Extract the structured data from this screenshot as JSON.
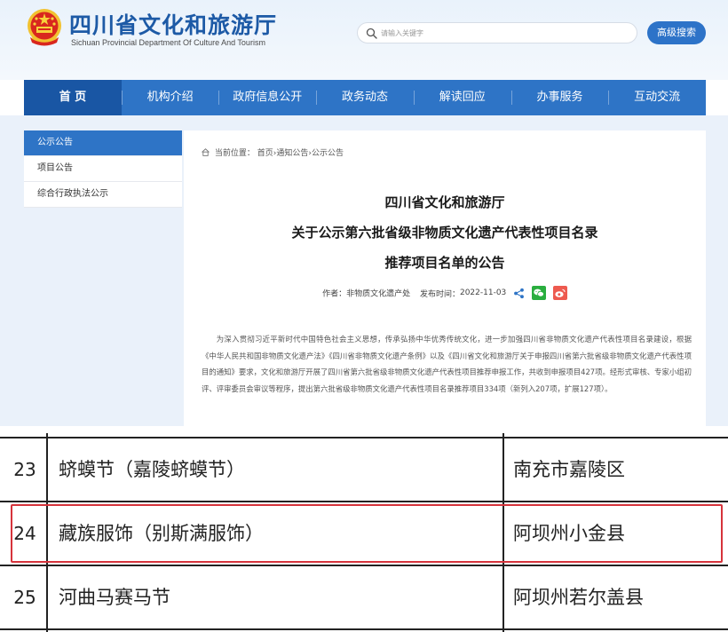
{
  "header": {
    "title": "四川省文化和旅游厅",
    "subtitle": "Sichuan Provincial Department Of Culture And Tourism",
    "search": {
      "placeholder": "请输入关键字",
      "value": ""
    },
    "advanced_search_label": "高级搜索"
  },
  "nav": {
    "items": [
      {
        "label": "首 页",
        "active": true
      },
      {
        "label": "机构介绍"
      },
      {
        "label": "政府信息公开"
      },
      {
        "label": "政务动态"
      },
      {
        "label": "解读回应"
      },
      {
        "label": "办事服务"
      },
      {
        "label": "互动交流"
      }
    ]
  },
  "sidebar": {
    "items": [
      {
        "label": "公示公告",
        "active": true
      },
      {
        "label": "项目公告"
      },
      {
        "label": "综合行政执法公示"
      }
    ]
  },
  "breadcrumb": {
    "prefix": "当前位置：",
    "items": [
      "首页",
      "通知公告",
      "公示公告"
    ],
    "separator": "›"
  },
  "article": {
    "title_lines": [
      "四川省文化和旅游厅",
      "关于公示第六批省级非物质文化遗产代表性项目名录",
      "推荐项目名单的公告"
    ],
    "author_label": "作者：",
    "author": "非物质文化遗产处",
    "date_label": "发布时间：",
    "date": "2022-11-03",
    "body": "为深入贯彻习近平新时代中国特色社会主义思想，传承弘扬中华优秀传统文化，进一步加强四川省非物质文化遗产代表性项目名录建设，根据《中华人民共和国非物质文化遗产法》《四川省非物质文化遗产条例》以及《四川省文化和旅游厅关于申报四川省第六批省级非物质文化遗产代表性项目的通知》要求，文化和旅游厅开展了四川省第六批省级非物质文化遗产代表性项目推荐申报工作，共收到申报项目427项。经形式审核、专家小组初评、评审委员会审议等程序，提出第六批省级非物质文化遗产代表性项目名录推荐项目334项（新列入207项，扩展127项）。"
  },
  "table": {
    "rows": [
      {
        "num": "23",
        "name": "蛴蟆节（嘉陵蛴蟆节）",
        "area": "南充市嘉陵区"
      },
      {
        "num": "24",
        "name": "藏族服饰（别斯满服饰）",
        "area": "阿坝州小金县",
        "highlighted": true
      },
      {
        "num": "25",
        "name": "河曲马赛马节",
        "area": "阿坝州若尔盖县"
      }
    ]
  },
  "colors": {
    "brand_blue": "#2e74c6",
    "nav_active": "#1956a4",
    "highlight_red": "#d6333b",
    "wechat_green": "#2aae3f",
    "weibo_red": "#ee5a4f",
    "share_blue": "#2e74c6"
  },
  "icons": {
    "emblem": "national-emblem-icon",
    "search": "search-icon",
    "home": "home-icon",
    "share": "share-icon",
    "wechat": "wechat-icon",
    "weibo": "weibo-icon"
  }
}
